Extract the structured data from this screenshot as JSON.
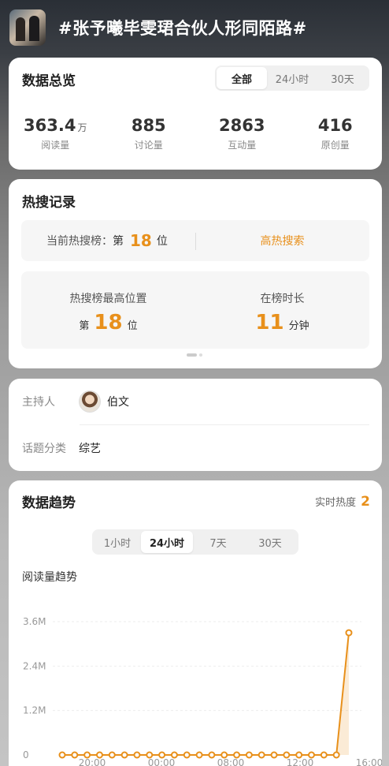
{
  "topic": {
    "title": "#张予曦毕雯珺合伙人形同陌路#"
  },
  "overview": {
    "title": "数据总览",
    "tabs": [
      "全部",
      "24小时",
      "30天"
    ],
    "active_tab": "全部",
    "stats": [
      {
        "value": "363.4",
        "unit": "万",
        "label": "阅读量"
      },
      {
        "value": "885",
        "unit": "",
        "label": "讨论量"
      },
      {
        "value": "2863",
        "unit": "",
        "label": "互动量"
      },
      {
        "value": "416",
        "unit": "",
        "label": "原创量"
      }
    ]
  },
  "hot_search": {
    "title": "热搜记录",
    "current_label": "当前热搜榜：",
    "current_prefix": "第",
    "current_rank": "18",
    "current_suffix": "位",
    "hot_tag": "高热搜索",
    "peak_label": "热搜榜最高位置",
    "peak_prefix": "第",
    "peak_rank": "18",
    "peak_suffix": "位",
    "duration_label": "在榜时长",
    "duration_value": "11",
    "duration_unit": "分钟"
  },
  "info": {
    "host_label": "主持人",
    "host_name": "伯文",
    "category_label": "话题分类",
    "category_value": "综艺"
  },
  "trend": {
    "title": "数据趋势",
    "realtime_label": "实时热度",
    "realtime_value": "2",
    "tabs": [
      "1小时",
      "24小时",
      "7天",
      "30天"
    ],
    "active_tab": "24小时",
    "subtitle": "阅读量趋势",
    "accent": "#e8901b"
  },
  "chart_data": {
    "type": "line",
    "ylabel": "",
    "xlabel": "",
    "y_tick_labels": [
      "0",
      "1.2M",
      "2.4M",
      "3.6M"
    ],
    "ylim": [
      0,
      3.6
    ],
    "y_unit": "M",
    "x_tick_labels": [
      "20:00",
      "00:00",
      "08:00",
      "12:00",
      "16:00"
    ],
    "series": [
      {
        "values": [
          0,
          0,
          0,
          0,
          0,
          0,
          0,
          0,
          0,
          0,
          0,
          0,
          0,
          0,
          0,
          0,
          0,
          0,
          0,
          0,
          0,
          0,
          0,
          3.3
        ]
      }
    ]
  }
}
